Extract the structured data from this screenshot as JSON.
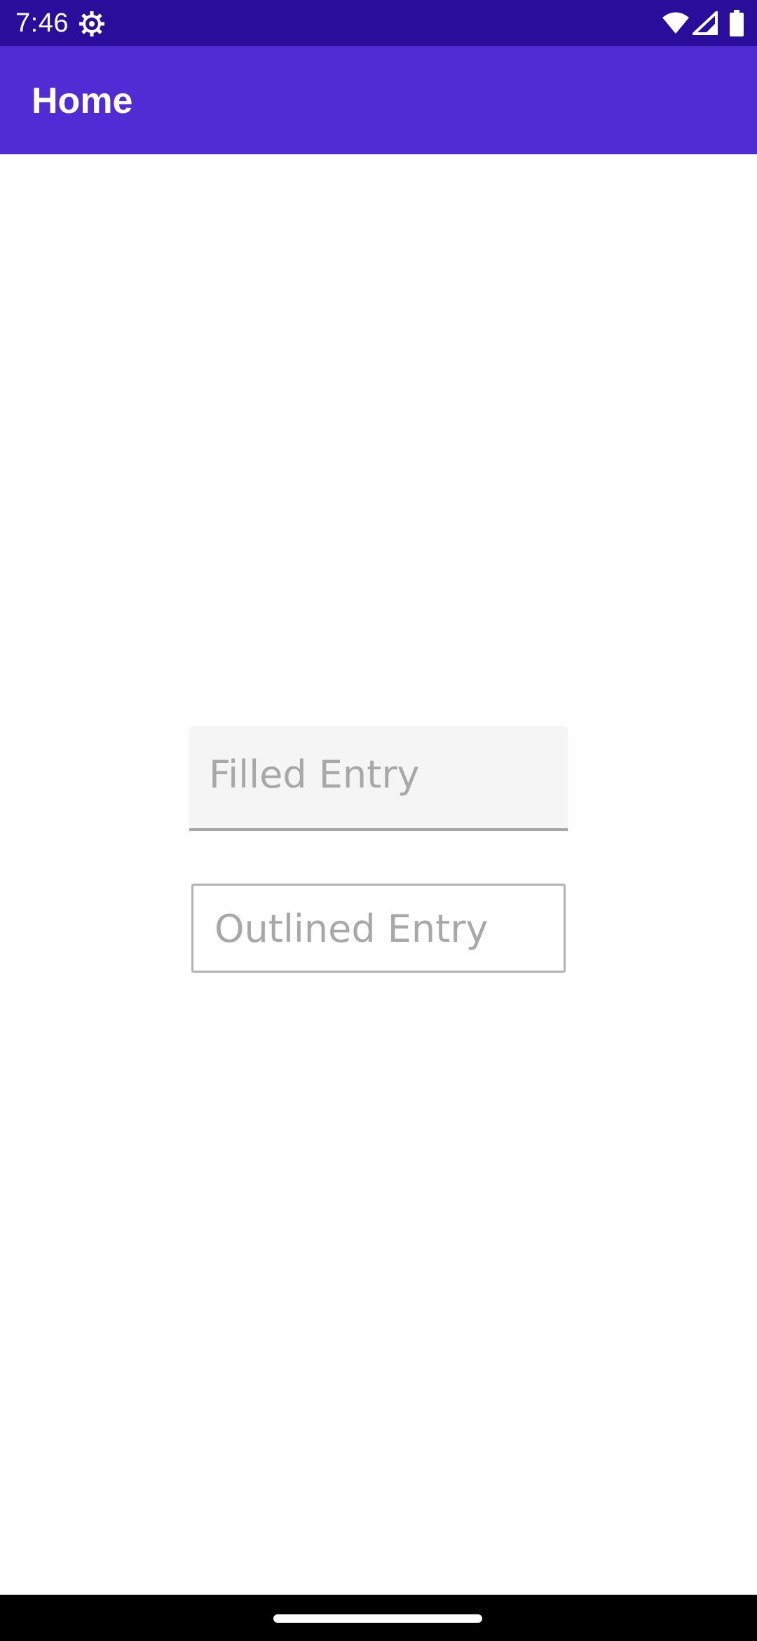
{
  "status_bar": {
    "time": "7:46",
    "background": "#2a0d9a",
    "icons": [
      "settings-gear-icon",
      "wifi-icon",
      "cell-signal-icon",
      "battery-icon"
    ]
  },
  "app_bar": {
    "title": "Home",
    "background": "#512bd4"
  },
  "form": {
    "filled_entry": {
      "value": "",
      "placeholder": "Filled Entry"
    },
    "outlined_entry": {
      "value": "",
      "placeholder": "Outlined Entry"
    }
  },
  "colors": {
    "placeholder_text": "#a8a8a8",
    "filled_background": "#f5f5f5",
    "underline": "#a6a6a6",
    "outline": "#b3b3b3"
  }
}
